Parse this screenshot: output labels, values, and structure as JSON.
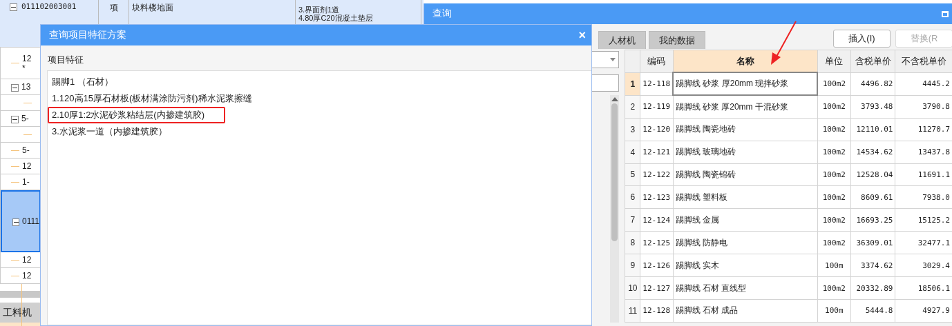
{
  "main_grid": {
    "top_row": {
      "expanded": true,
      "code": "011102003001",
      "unit": "项",
      "name": "块料楼地面",
      "description_lines": [
        "3.界面剂1道",
        "4.80厚C20混凝土垫层"
      ]
    },
    "tree_rows": [
      {
        "kind": "item",
        "lines": [
          "12",
          "*"
        ],
        "selected": false
      },
      {
        "kind": "group",
        "lines": [
          "13"
        ],
        "expanded": true,
        "selected": false
      },
      {
        "kind": "sub",
        "selected": false
      },
      {
        "kind": "group",
        "lines": [
          "5-"
        ],
        "expanded": true,
        "selected": false
      },
      {
        "kind": "sub",
        "selected": false
      },
      {
        "kind": "item",
        "lines": [
          "5-"
        ],
        "selected": false
      },
      {
        "kind": "item",
        "lines": [
          "12"
        ],
        "selected": false
      },
      {
        "kind": "item",
        "lines": [
          "1-"
        ],
        "selected": false
      },
      {
        "kind": "group",
        "lines": [
          "0111"
        ],
        "expanded": true,
        "selected": true
      },
      {
        "kind": "item",
        "lines": [
          "12"
        ],
        "selected": false
      },
      {
        "kind": "item",
        "lines": [
          "12"
        ],
        "selected": false
      }
    ],
    "bottom_tab": "工料机"
  },
  "query_window": {
    "title": "查询",
    "tabs": [
      {
        "label": "人材机",
        "selected": false
      },
      {
        "label": "我的数据",
        "selected": false
      }
    ],
    "buttons": [
      {
        "label": "插入(I)",
        "disabled": false
      },
      {
        "label": "替换(R",
        "disabled": true
      }
    ],
    "table": {
      "columns": [
        {
          "label": "编码",
          "selected": false
        },
        {
          "label": "名称",
          "selected": true
        },
        {
          "label": "单位",
          "selected": false
        },
        {
          "label": "含税单价",
          "selected": false
        },
        {
          "label": "不含税单价",
          "selected": false
        }
      ],
      "rows": [
        {
          "num": "1",
          "selected": true,
          "cells": [
            "12-118",
            "踢脚线 砂浆 厚20mm 现拌砂浆",
            "100m2",
            "4496.82",
            "4445.2"
          ]
        },
        {
          "num": "2",
          "selected": false,
          "cells": [
            "12-119",
            "踢脚线 砂浆 厚20mm 干混砂浆",
            "100m2",
            "3793.48",
            "3790.8"
          ]
        },
        {
          "num": "3",
          "selected": false,
          "cells": [
            "12-120",
            "踢脚线 陶瓷地砖",
            "100m2",
            "12110.01",
            "11270.7"
          ]
        },
        {
          "num": "4",
          "selected": false,
          "cells": [
            "12-121",
            "踢脚线 玻璃地砖",
            "100m2",
            "14534.62",
            "13437.8"
          ]
        },
        {
          "num": "5",
          "selected": false,
          "cells": [
            "12-122",
            "踢脚线 陶瓷锦砖",
            "100m2",
            "12528.04",
            "11691.1"
          ]
        },
        {
          "num": "6",
          "selected": false,
          "cells": [
            "12-123",
            "踢脚线 塑料板",
            "100m2",
            "8609.61",
            "7938.0"
          ]
        },
        {
          "num": "7",
          "selected": false,
          "cells": [
            "12-124",
            "踢脚线 金属",
            "100m2",
            "16693.25",
            "15125.2"
          ]
        },
        {
          "num": "8",
          "selected": false,
          "cells": [
            "12-125",
            "踢脚线 防静电",
            "100m2",
            "36309.01",
            "32477.1"
          ]
        },
        {
          "num": "9",
          "selected": false,
          "cells": [
            "12-126",
            "踢脚线 实木",
            "100m",
            "3374.62",
            "3029.4"
          ]
        },
        {
          "num": "10",
          "selected": false,
          "cells": [
            "12-127",
            "踢脚线 石材 直线型",
            "100m2",
            "20332.89",
            "18506.1"
          ]
        },
        {
          "num": "11",
          "selected": false,
          "cells": [
            "12-128",
            "踢脚线 石材 成品",
            "100m",
            "5444.8",
            "4927.9"
          ]
        }
      ]
    }
  },
  "dialog": {
    "title": "查询项目特征方案",
    "close": "×",
    "section_label": "项目特征",
    "lines": [
      {
        "text": "踢脚1 （石材）",
        "highlighted": false
      },
      {
        "text": "1.120高15厚石材板(板材满涂防污剂)稀水泥浆擦缝",
        "highlighted": false
      },
      {
        "text": "2.10厚1:2水泥砂浆粘结层(内掺建筑胶)",
        "highlighted": true
      },
      {
        "text": "3.水泥浆一道（内掺建筑胶）",
        "highlighted": false
      }
    ]
  }
}
